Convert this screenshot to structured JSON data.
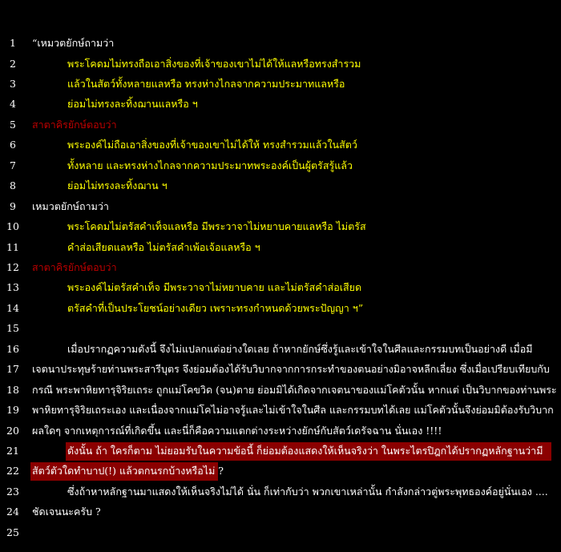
{
  "colors": {
    "background": "#000000",
    "text_white": "#ffffff",
    "text_yellow": "#ffff00",
    "text_maroon": "#c00000",
    "highlight": "#8b0000"
  },
  "lines": [
    {
      "n": "1",
      "text": "“เหมวตยักษ์ถามว่า",
      "style": "white",
      "indent": 0
    },
    {
      "n": "2",
      "text": "พระโคดมไม่ทรงถือเอาสิ่งของที่เจ้าของเขาไม่ได้ให้แลหรือทรงสำรวม",
      "style": "yellow",
      "indent": 1
    },
    {
      "n": "3",
      "text": "แล้วในสัตว์ทั้งหลายแลหรือ ทรงห่างไกลจากความประมาทแลหรือ",
      "style": "yellow",
      "indent": 1
    },
    {
      "n": "4",
      "text": "ย่อมไม่ทรงละทิ้งฌานแลหรือ ฯ",
      "style": "yellow",
      "indent": 1
    },
    {
      "n": "5",
      "text": "สาตาคิรยักษ์ตอบว่า",
      "style": "maroon",
      "indent": 0
    },
    {
      "n": "6",
      "text": "พระองค์ไม่ถือเอาสิ่งของที่เจ้าของเขาไม่ได้ให้ ทรงสำรวมแล้วในสัตว์",
      "style": "yellow",
      "indent": 1
    },
    {
      "n": "7",
      "text": "ทั้งหลาย และทรงห่างไกลจากความประมาทพระองค์เป็นผู้ตรัสรู้แล้ว",
      "style": "yellow",
      "indent": 1
    },
    {
      "n": "8",
      "text": "ย่อมไม่ทรงละทิ้งฌาน ฯ",
      "style": "yellow",
      "indent": 1
    },
    {
      "n": "9",
      "text": "เหมวตยักษ์ถามว่า",
      "style": "white",
      "indent": 0
    },
    {
      "n": "10",
      "text": "พระโคดมไม่ตรัสคำเท็จแลหรือ มีพระวาจาไม่หยาบคายแลหรือ ไม่ตรัส",
      "style": "yellow",
      "indent": 1
    },
    {
      "n": "11",
      "text": "คำส่อเสียดแลหรือ ไม่ตรัสคำเพ้อเจ้อแลหรือ ฯ",
      "style": "yellow",
      "indent": 1
    },
    {
      "n": "12",
      "text": "สาตาคิรยักษ์ตอบว่า",
      "style": "maroon",
      "indent": 0
    },
    {
      "n": "13",
      "text": "พระองค์ไม่ตรัสคำเท็จ มีพระวาจาไม่หยาบคาย และไม่ตรัสคำส่อเสียด",
      "style": "yellow",
      "indent": 1
    },
    {
      "n": "14",
      "text": "ตรัสคำที่เป็นประโยชน์อย่างเดียว เพราะทรงกำหนดด้วยพระปัญญา ฯ”",
      "style": "yellow",
      "indent": 1
    },
    {
      "n": "15",
      "text": "",
      "style": "white",
      "indent": 0
    },
    {
      "n": "16",
      "text": "เมื่อปรากฏความดังนี้ จึงไม่แปลกแต่อย่างใดเลย       ถ้าหากยักษ์ซึ่งรู้และเข้าใจในศีลและกรรมบทเป็นอย่างดี เมื่อมี",
      "style": "white",
      "indent": 1
    },
    {
      "n": "17",
      "text": "เจตนาประทุษร้ายท่านพระสารีบุตร จึงย่อมต้องได้รับวิบากจากการกระทำของตนอย่างมิอาจหลีกเลี่ยง ซึ่งเมื่อเปรียบเทียบกับ",
      "style": "white",
      "indent": 0
    },
    {
      "n": "18",
      "text": "กรณี  พระพาหิยทารุจิริยเถระ ถูกแม่โคขวิด (จน)ตาย  ย่อมมิได้เกิดจากเจตนาของแม่โคตัวนั้น หากแต่ เป็นวิบากของท่านพระ",
      "style": "white",
      "indent": 0
    },
    {
      "n": "19",
      "text": "พาหิยทารุจิริยเถระเอง และเนื่องจากแม่โคไม่อาจรู้และไม่เข้าใจในศีล และกรรมบทได้เลย แม่โคตัวนั้นจึงย่อมมิต้องรับวิบาก",
      "style": "white",
      "indent": 0
    },
    {
      "n": "20",
      "text": "ผลใดๆ จากเหตุการณ์ที่เกิดขึ้น และนี่ก็คือความแตกต่างระหว่างยักษ์กับสัตว์เดรัจฉาน นั่นเอง !!!!",
      "style": "white",
      "indent": 0
    },
    {
      "n": "21",
      "text": "ดังนั้น ถ้า ใครก็ตาม  ไม่ยอมรับในความข้อนี้ ก็ย่อมต้องแสดงให้เห็นจริงว่า ในพระไตรปิฎกได้ปรากฏหลักฐานว่ามี",
      "style": "white",
      "indent": 1,
      "highlight": true
    },
    {
      "n": "22",
      "text": "สัตว์ตัวใดทำบาป(!) แล้วตกนรกบ้างหรือไม่ ?",
      "style": "white",
      "indent": 0,
      "highlight": true
    },
    {
      "n": "23",
      "text": "ซึ่งถ้าหาหลักฐานมาแสดงให้เห็นจริงไม่ได้ นั่น ก็เท่ากับว่า  พวกเขาเหล่านั้น  กำลังกล่าวตู่พระพุทธองค์อยู่นั่นเอง ....",
      "style": "white",
      "indent": 1
    },
    {
      "n": "24",
      "text": "ชัดเจนนะครับ ?",
      "style": "white",
      "indent": 0
    },
    {
      "n": "25",
      "text": "",
      "style": "white",
      "indent": 0
    }
  ]
}
